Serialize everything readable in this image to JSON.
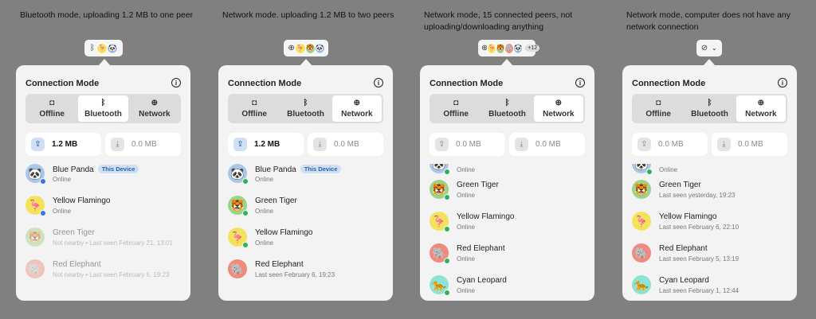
{
  "colors": {
    "blue_dot": "#3b74e0",
    "green_dot": "#2fb35a",
    "badge_bg": "#cfe0f5",
    "badge_text": "#2a5ea8"
  },
  "panels": [
    {
      "caption": "Bluetooth mode, uploading 1.2 MB to one peer",
      "trigger": {
        "icons": [
          "bluetooth-icon"
        ],
        "avatars": [
          "🦩",
          "🐼"
        ],
        "count": "",
        "chevron": ""
      },
      "title": "Connection Mode",
      "modes": [
        {
          "label": "Offline",
          "icon": "◘",
          "active": false
        },
        {
          "label": "Bluetooth",
          "icon": "ᛒ",
          "active": true
        },
        {
          "label": "Network",
          "icon": "⊕",
          "active": false
        }
      ],
      "upload": {
        "value": "1.2 MB",
        "active": true
      },
      "download": {
        "value": "0.0 MB",
        "active": false
      },
      "peers": [
        {
          "name": "Blue Panda",
          "badge": "This Device",
          "status": "Online",
          "emoji": "🐼",
          "bg": "#a9c7ea",
          "dot": "blue",
          "faded": false
        },
        {
          "name": "Yellow Flamingo",
          "badge": "",
          "status": "Online",
          "emoji": "🦩",
          "bg": "#f4e35a",
          "dot": "blue",
          "faded": false
        },
        {
          "name": "Green Tiger",
          "badge": "",
          "status": "Not nearby • Last seen February 21, 13:01",
          "emoji": "🐯",
          "bg": "#9ad48a",
          "dot": "",
          "faded": true
        },
        {
          "name": "Red Elephant",
          "badge": "",
          "status": "Not nearby • Last seen February 6, 19:23",
          "emoji": "🐘",
          "bg": "#f08a7e",
          "dot": "",
          "faded": true
        }
      ]
    },
    {
      "caption": "Network mode. uploading 1.2 MB to two peers",
      "trigger": {
        "icons": [
          "network-icon"
        ],
        "avatars": [
          "🦩",
          "🐯",
          "🐼"
        ],
        "count": "",
        "chevron": ""
      },
      "title": "Connection Mode",
      "modes": [
        {
          "label": "Offline",
          "icon": "◘",
          "active": false
        },
        {
          "label": "Bluetooth",
          "icon": "ᛒ",
          "active": false
        },
        {
          "label": "Network",
          "icon": "⊕",
          "active": true
        }
      ],
      "upload": {
        "value": "1.2 MB",
        "active": true
      },
      "download": {
        "value": "0.0 MB",
        "active": false
      },
      "peers": [
        {
          "name": "Blue Panda",
          "badge": "This Device",
          "status": "Online",
          "emoji": "🐼",
          "bg": "#a9c7ea",
          "dot": "green",
          "faded": false
        },
        {
          "name": "Green Tiger",
          "badge": "",
          "status": "Online",
          "emoji": "🐯",
          "bg": "#9ad48a",
          "dot": "green",
          "faded": false
        },
        {
          "name": "Yellow Flamingo",
          "badge": "",
          "status": "Online",
          "emoji": "🦩",
          "bg": "#f4e35a",
          "dot": "green",
          "faded": false
        },
        {
          "name": "Red Elephant",
          "badge": "",
          "status": "Last seen February 6, 19:23",
          "emoji": "🐘",
          "bg": "#f08a7e",
          "dot": "",
          "faded": false
        }
      ]
    },
    {
      "caption": "Network mode, 15 connected peers, not uploading/downloading anything",
      "trigger": {
        "icons": [
          "network-icon"
        ],
        "avatars": [
          "🦩",
          "🐯",
          "🐘",
          "🐼"
        ],
        "count": "+12",
        "chevron": ""
      },
      "title": "Connection Mode",
      "modes": [
        {
          "label": "Offline",
          "icon": "◘",
          "active": false
        },
        {
          "label": "Bluetooth",
          "icon": "ᛒ",
          "active": false
        },
        {
          "label": "Network",
          "icon": "⊕",
          "active": true
        }
      ],
      "upload": {
        "value": "0.0 MB",
        "active": false
      },
      "download": {
        "value": "0.0 MB",
        "active": false
      },
      "peers": [
        {
          "name": "",
          "badge": "",
          "status": "Online",
          "emoji": "🐼",
          "bg": "#a9c7ea",
          "dot": "green",
          "faded": false
        },
        {
          "name": "Green Tiger",
          "badge": "",
          "status": "Online",
          "emoji": "🐯",
          "bg": "#9ad48a",
          "dot": "green",
          "faded": false
        },
        {
          "name": "Yellow Flamingo",
          "badge": "",
          "status": "Online",
          "emoji": "🦩",
          "bg": "#f4e35a",
          "dot": "green",
          "faded": false
        },
        {
          "name": "Red Elephant",
          "badge": "",
          "status": "Online",
          "emoji": "🐘",
          "bg": "#f08a7e",
          "dot": "green",
          "faded": false
        },
        {
          "name": "Cyan Leopard",
          "badge": "",
          "status": "Online",
          "emoji": "🐆",
          "bg": "#8fe3d4",
          "dot": "green",
          "faded": false
        }
      ]
    },
    {
      "caption": "Network mode, computer does not have any network connection",
      "trigger": {
        "icons": [
          "network-off-icon"
        ],
        "avatars": [],
        "count": "",
        "chevron": "⌄"
      },
      "title": "Connection Mode",
      "modes": [
        {
          "label": "Offline",
          "icon": "◘",
          "active": false
        },
        {
          "label": "Bluetooth",
          "icon": "ᛒ",
          "active": false
        },
        {
          "label": "Network",
          "icon": "⊕",
          "active": true
        }
      ],
      "upload": {
        "value": "0.0 MB",
        "active": false
      },
      "download": {
        "value": "0.0 MB",
        "active": false
      },
      "peers": [
        {
          "name": "",
          "badge": "",
          "status": "Online",
          "emoji": "🐼",
          "bg": "#a9c7ea",
          "dot": "green",
          "faded": false
        },
        {
          "name": "Green Tiger",
          "badge": "",
          "status": "Last seen yesterday, 19:23",
          "emoji": "🐯",
          "bg": "#9ad48a",
          "dot": "",
          "faded": false
        },
        {
          "name": "Yellow Flamingo",
          "badge": "",
          "status": "Last seen February 6, 22:10",
          "emoji": "🦩",
          "bg": "#f4e35a",
          "dot": "",
          "faded": false
        },
        {
          "name": "Red Elephant",
          "badge": "",
          "status": "Last seen February 5, 13:19",
          "emoji": "🐘",
          "bg": "#f08a7e",
          "dot": "",
          "faded": false
        },
        {
          "name": "Cyan Leopard",
          "badge": "",
          "status": "Last seen February 1, 12:44",
          "emoji": "🐆",
          "bg": "#8fe3d4",
          "dot": "",
          "faded": false
        }
      ]
    }
  ]
}
